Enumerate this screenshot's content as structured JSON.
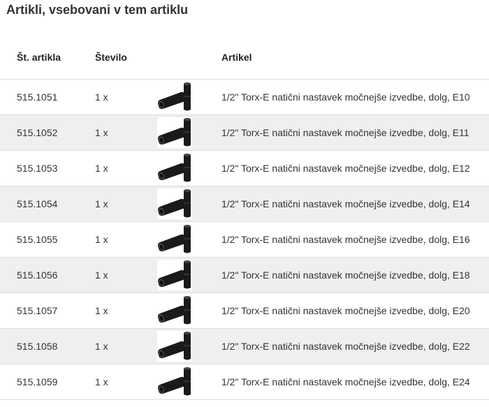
{
  "page": {
    "title": "Artikli, vsebovani v tem artiklu"
  },
  "table": {
    "headers": {
      "article_number": "Št. artikla",
      "quantity": "Število",
      "image": "",
      "article": "Artikel"
    },
    "rows": [
      {
        "number": "515.1051",
        "quantity": "1 x",
        "image_icon": "socket-image-icon",
        "description": "1/2\" Torx-E natični nastavek močnejše izvedbe, dolg, E10"
      },
      {
        "number": "515.1052",
        "quantity": "1 x",
        "image_icon": "socket-image-icon",
        "description": "1/2\" Torx-E natični nastavek močnejše izvedbe, dolg, E11"
      },
      {
        "number": "515.1053",
        "quantity": "1 x",
        "image_icon": "socket-image-icon",
        "description": "1/2\" Torx-E natični nastavek močnejše izvedbe, dolg, E12"
      },
      {
        "number": "515.1054",
        "quantity": "1 x",
        "image_icon": "socket-image-icon",
        "description": "1/2\" Torx-E natični nastavek močnejše izvedbe, dolg, E14"
      },
      {
        "number": "515.1055",
        "quantity": "1 x",
        "image_icon": "socket-image-icon",
        "description": "1/2\" Torx-E natični nastavek močnejše izvedbe, dolg, E16"
      },
      {
        "number": "515.1056",
        "quantity": "1 x",
        "image_icon": "socket-image-icon",
        "description": "1/2\" Torx-E natični nastavek močnejše izvedbe, dolg, E18"
      },
      {
        "number": "515.1057",
        "quantity": "1 x",
        "image_icon": "socket-image-icon",
        "description": "1/2\" Torx-E natični nastavek močnejše izvedbe, dolg, E20"
      },
      {
        "number": "515.1058",
        "quantity": "1 x",
        "image_icon": "socket-image-icon",
        "description": "1/2\" Torx-E natični nastavek močnejše izvedbe, dolg, E22"
      },
      {
        "number": "515.1059",
        "quantity": "1 x",
        "image_icon": "socket-image-icon",
        "description": "1/2\" Torx-E natični nastavek močnejše izvedbe, dolg, E24"
      }
    ]
  },
  "colors": {
    "text": "#333333",
    "row_alt_background": "#efefef",
    "divider": "#dddddd",
    "product_black": "#1a1a1a"
  }
}
